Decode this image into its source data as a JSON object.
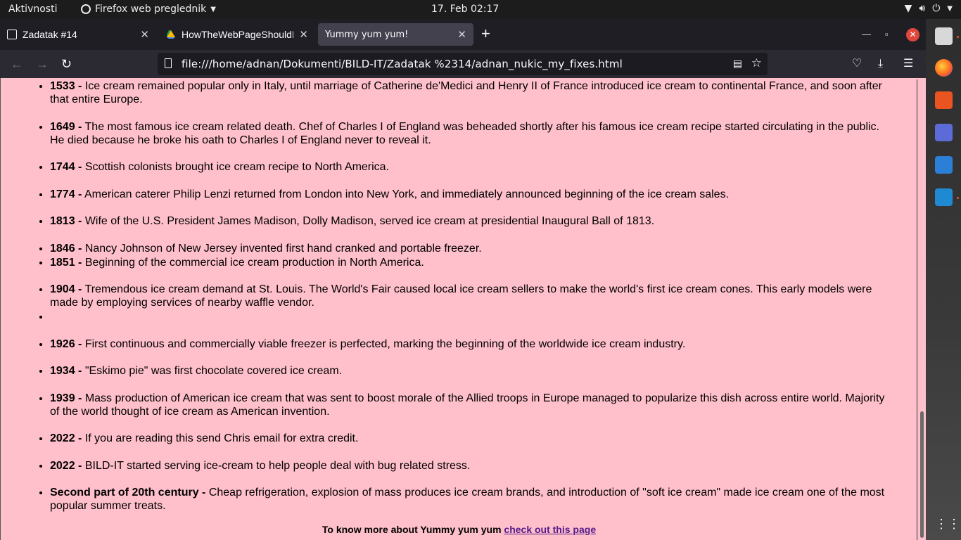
{
  "topbar": {
    "activities": "Aktivnosti",
    "app_name": "Firefox web preglednik",
    "clock": "17. Feb  02:17"
  },
  "tabs": [
    {
      "title": "Zadatak #14"
    },
    {
      "title": "HowTheWebPageShouldL"
    },
    {
      "title": "Yummy yum yum!",
      "active": true
    }
  ],
  "urlbar": {
    "url": "file:///home/adnan/Dokumenti/BILD-IT/Zadatak %2314/adnan_nukic_my_fixes.html"
  },
  "page": {
    "background": "#ffc0cb",
    "items": [
      {
        "year": "1533 -",
        "text": "Ice cream remained popular only in Italy, until marriage of Catherine de'Medici and Henry II of France introduced ice cream to continental France, and soon after that entire Europe."
      },
      {
        "year": "1649 -",
        "text": "The most famous ice cream related death. Chef of Charles I of England was beheaded shortly after his famous ice cream recipe started circulating in the public. He died because he broke his oath to Charles I of England never to reveal it."
      },
      {
        "year": "1744 -",
        "text": "Scottish colonists brought ice cream recipe to North America."
      },
      {
        "year": "1774 -",
        "text": "American caterer Philip Lenzi returned from London into New York, and immediately announced beginning of the ice cream sales."
      },
      {
        "year": "1813 -",
        "text": "Wife of the U.S. President James Madison, Dolly Madison, served ice cream at presidential Inaugural Ball of 1813."
      },
      {
        "year": "1846 -",
        "text": "Nancy Johnson of New Jersey invented first hand cranked and portable freezer."
      },
      {
        "year": "1851 -",
        "text": "Beginning of the commercial ice cream production in North America."
      },
      {
        "year": "1904 -",
        "text": "Tremendous ice cream demand at St. Louis. The World's Fair caused local ice cream sellers to make the world's first ice cream cones. This early models were made by employing services of nearby waffle vendor."
      },
      {
        "year": "",
        "text": ""
      },
      {
        "year": "1926 -",
        "text": "First continuous and commercially viable freezer is perfected, marking the beginning of the worldwide ice cream industry."
      },
      {
        "year": "1934 -",
        "text": "\"Eskimo pie\" was first chocolate covered ice cream."
      },
      {
        "year": "1939 -",
        "text": "Mass production of American ice cream that was sent to boost morale of the Allied troops in Europe managed to popularize this dish across entire world. Majority of the world thought of ice cream as American invention."
      },
      {
        "year": "2022 -",
        "text": "If you are reading this send Chris email for extra credit."
      },
      {
        "year": "2022 -",
        "text": "BILD-IT started serving ice-cream to help people deal with bug related stress."
      },
      {
        "year": "Second part of 20th century -",
        "text": "Cheap refrigeration, explosion of mass produces ice cream brands, and introduction of \"soft ice cream\" made ice cream one of the most popular summer treats."
      }
    ],
    "footer_text": "To know more about Yummy yum yum",
    "footer_link": "check out this page"
  },
  "icons": {
    "app": "firefox-icon",
    "network": "wifi-icon",
    "volume": "volume-icon",
    "power": "power-icon"
  }
}
